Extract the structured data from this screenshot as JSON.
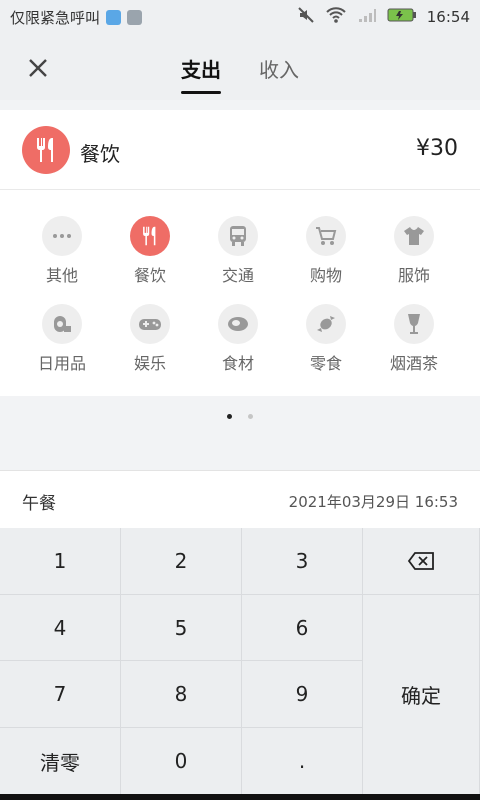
{
  "status_bar": {
    "carrier_text": "仅限紧急呼叫",
    "time": "16:54",
    "icons": [
      "usb-icon",
      "image-icon",
      "mute-icon",
      "wifi-icon",
      "signal-icon",
      "battery-icon"
    ]
  },
  "header": {
    "tabs": [
      {
        "label": "支出",
        "active": true
      },
      {
        "label": "收入",
        "active": false
      }
    ]
  },
  "selected_category": {
    "name": "餐饮",
    "amount": "¥30",
    "icon": "fork-knife-icon",
    "accent_color": "#ef6d66"
  },
  "category_grid": [
    {
      "label": "其他",
      "icon": "more-icon"
    },
    {
      "label": "餐饮",
      "icon": "fork-knife-icon",
      "selected": true
    },
    {
      "label": "交通",
      "icon": "bus-icon"
    },
    {
      "label": "购物",
      "icon": "cart-icon"
    },
    {
      "label": "服饰",
      "icon": "shirt-icon"
    },
    {
      "label": "日用品",
      "icon": "tissue-roll-icon"
    },
    {
      "label": "娱乐",
      "icon": "gamepad-icon"
    },
    {
      "label": "食材",
      "icon": "meat-icon"
    },
    {
      "label": "零食",
      "icon": "candy-icon"
    },
    {
      "label": "烟酒茶",
      "icon": "wine-glass-icon"
    }
  ],
  "pager": {
    "pages": 2,
    "current": 1
  },
  "note": {
    "text": "午餐",
    "datetime": "2021年03月29日 16:53"
  },
  "keypad": {
    "keys": [
      "1",
      "2",
      "3",
      "4",
      "5",
      "6",
      "7",
      "8",
      "9",
      "清零",
      "0",
      "."
    ],
    "backspace": "backspace-icon",
    "confirm": "确定"
  }
}
